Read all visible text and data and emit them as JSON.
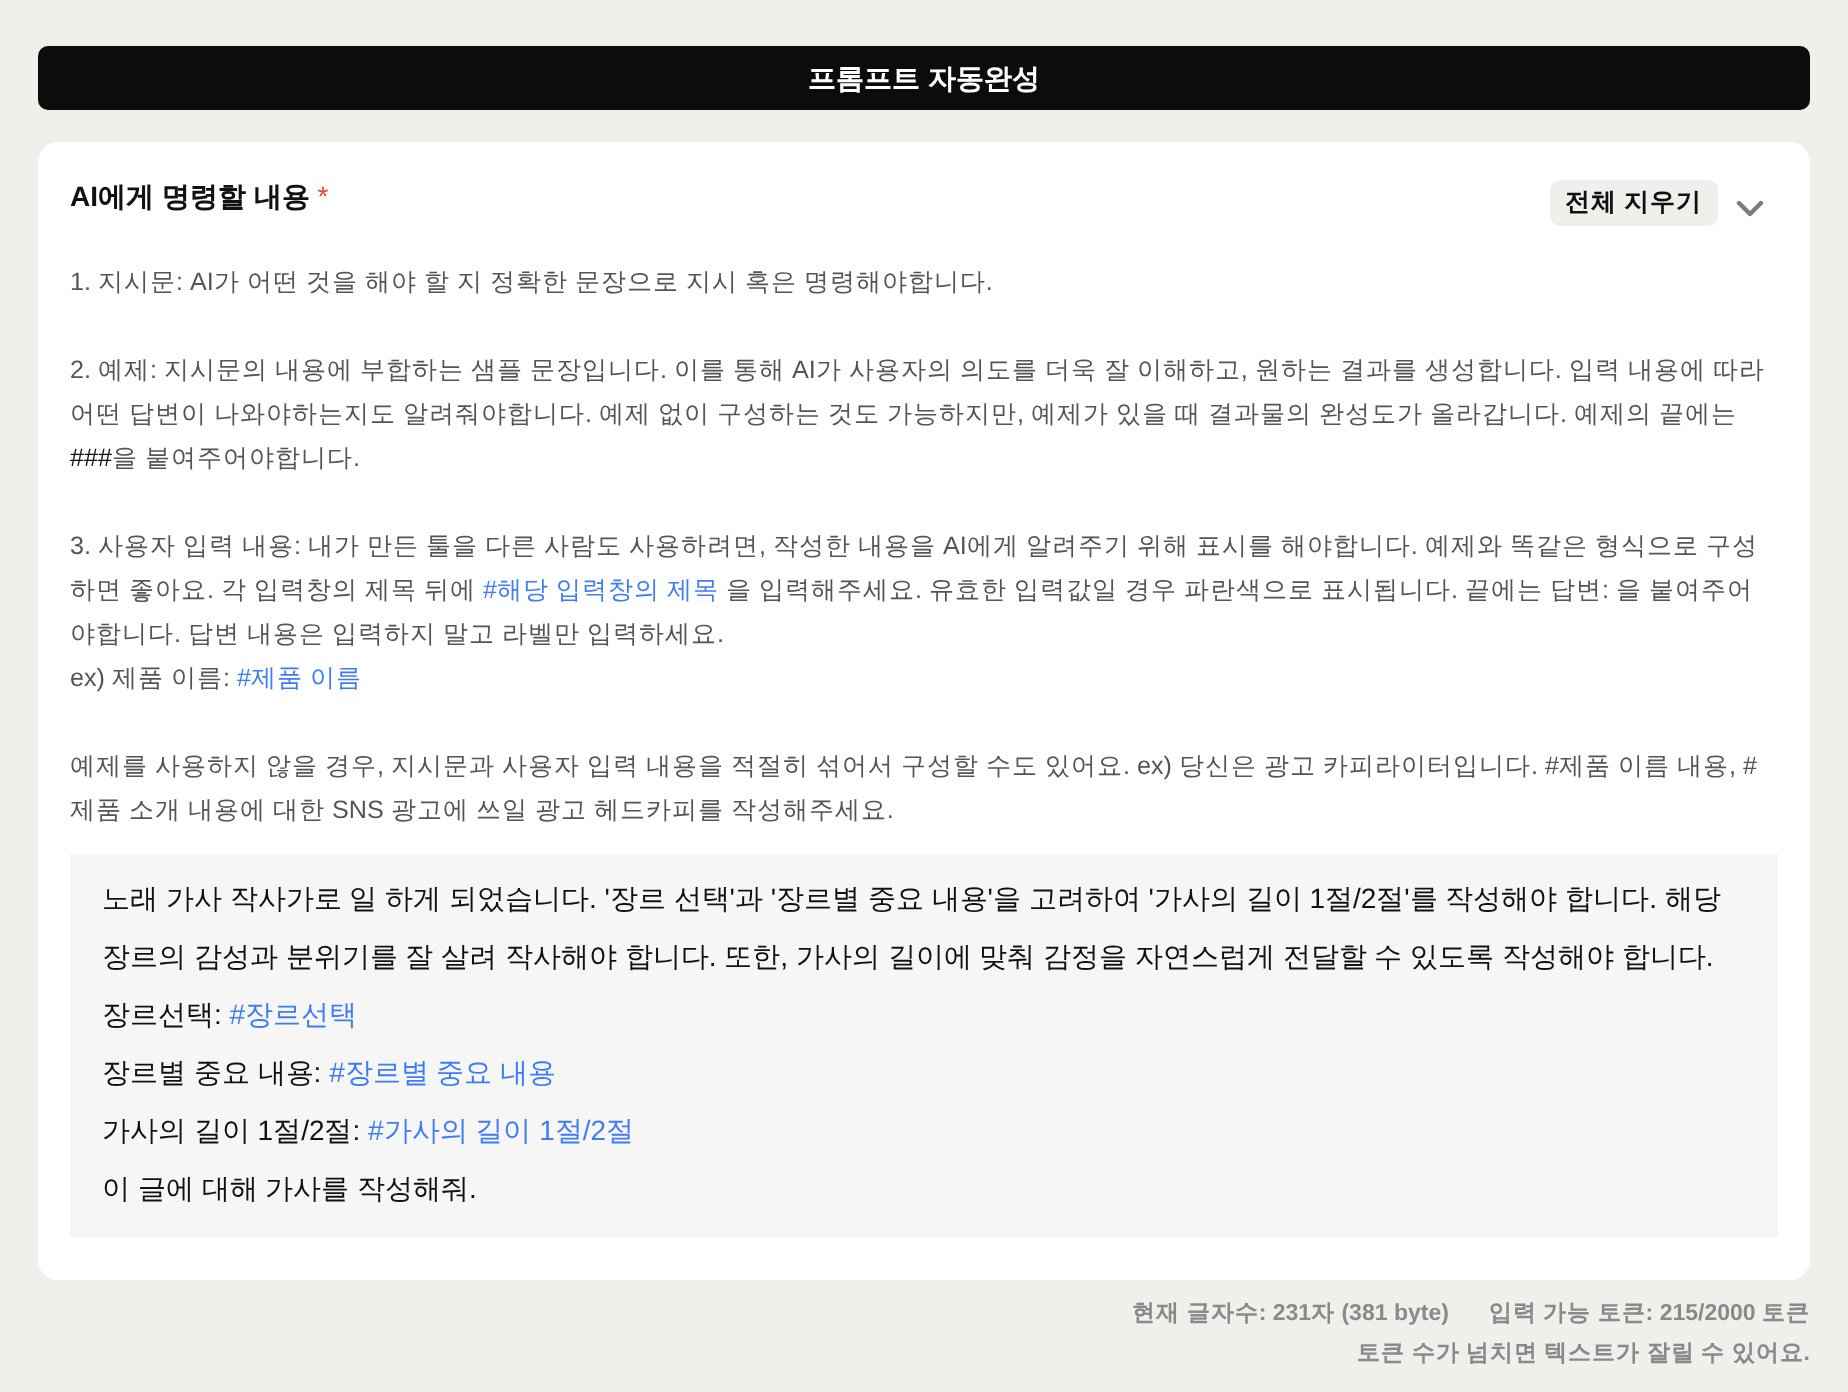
{
  "header": {
    "title": "프롬프트 자동완성"
  },
  "section": {
    "title": "AI에게 명령할 내용",
    "required_mark": "*",
    "clear_button": "전체 지우기",
    "expanded": true
  },
  "instructions": [
    [
      {
        "segments": [
          {
            "kind": "plain",
            "text": "1. 지시문: AI가 어떤 것을 해야 할 지 정확한 문장으로 지시 혹은 명령해야합니다."
          }
        ]
      }
    ],
    [
      {
        "segments": [
          {
            "kind": "plain",
            "text": "2. 예제: 지시문의 내용에 부합하는 샘플 문장입니다. 이를 통해 AI가 사용자의 의도를 더욱 잘 이해하고, 원하는 결과를 생성합니다. 입력 내용에 따라 어떤 답변이 나와야하는지도 알려줘야합니다. 예제 없이 구성하는 것도 가능하지만, 예제가 있을 때 결과물의 완성도가 올라갑니다. 예제의 끝에는 "
          },
          {
            "kind": "strong",
            "text": "###"
          },
          {
            "kind": "plain",
            "text": "을 붙여주어야합니다."
          }
        ]
      }
    ],
    [
      {
        "segments": [
          {
            "kind": "plain",
            "text": "3. 사용자 입력 내용: 내가 만든 툴을 다른 사람도 사용하려면, 작성한 내용을 AI에게 알려주기 위해 표시를 해야합니다. 예제와 똑같은 형식으로 구성하면 좋아요. 각 입력창의 제목 뒤에 "
          },
          {
            "kind": "token",
            "text": "#해당 입력창의 제목"
          },
          {
            "kind": "plain",
            "text": " 을 입력해주세요. 유효한 입력값일 경우 파란색으로 표시됩니다. 끝에는 답변: 을 붙여주어야합니다. 답변 내용은 입력하지 말고 라벨만 입력하세요."
          }
        ]
      },
      {
        "segments": [
          {
            "kind": "plain",
            "text": "ex) 제품 이름: "
          },
          {
            "kind": "token",
            "text": "#제품 이름"
          }
        ]
      }
    ],
    [
      {
        "segments": [
          {
            "kind": "plain",
            "text": "예제를 사용하지 않을 경우, 지시문과 사용자 입력 내용을 적절히 섞어서 구성할 수도 있어요. ex) 당신은 광고 카피라이터입니다. #제품 이름 내용, #제품 소개 내용에 대한 SNS 광고에 쓰일 광고 헤드카피를 작성해주세요."
          }
        ]
      }
    ]
  ],
  "prompt": {
    "lines": [
      {
        "segments": [
          {
            "kind": "plain",
            "text": "노래 가사 작사가로 일 하게 되었습니다. '장르 선택'과 '장르별 중요 내용'을 고려하여 '가사의 길이 1절/2절'를 작성해야 합니다. 해당 장르의 감성과 분위기를 잘 살려 작사해야 합니다. 또한, 가사의 길이에 맞춰 감정을 자연스럽게 전달할 수 있도록 작성해야 합니다."
          }
        ]
      },
      {
        "segments": [
          {
            "kind": "plain",
            "text": "장르선택: "
          },
          {
            "kind": "token",
            "text": "#장르선택"
          }
        ]
      },
      {
        "segments": [
          {
            "kind": "plain",
            "text": "장르별 중요 내용: "
          },
          {
            "kind": "token",
            "text": "#장르별 중요 내용"
          }
        ]
      },
      {
        "segments": [
          {
            "kind": "plain",
            "text": "가사의 길이 1절/2절: "
          },
          {
            "kind": "token",
            "text": "#가사의 길이 1절/2절"
          }
        ]
      },
      {
        "segments": [
          {
            "kind": "plain",
            "text": "이 글에 대해 가사를 작성해줘."
          }
        ]
      }
    ]
  },
  "footer": {
    "counts": [
      "현재 글자수: 231자 (381 byte)",
      "입력 가능 토큰: 215/2000 토큰"
    ],
    "note": "토큰 수가 넘치면 텍스트가 잘릴 수 있어요."
  }
}
